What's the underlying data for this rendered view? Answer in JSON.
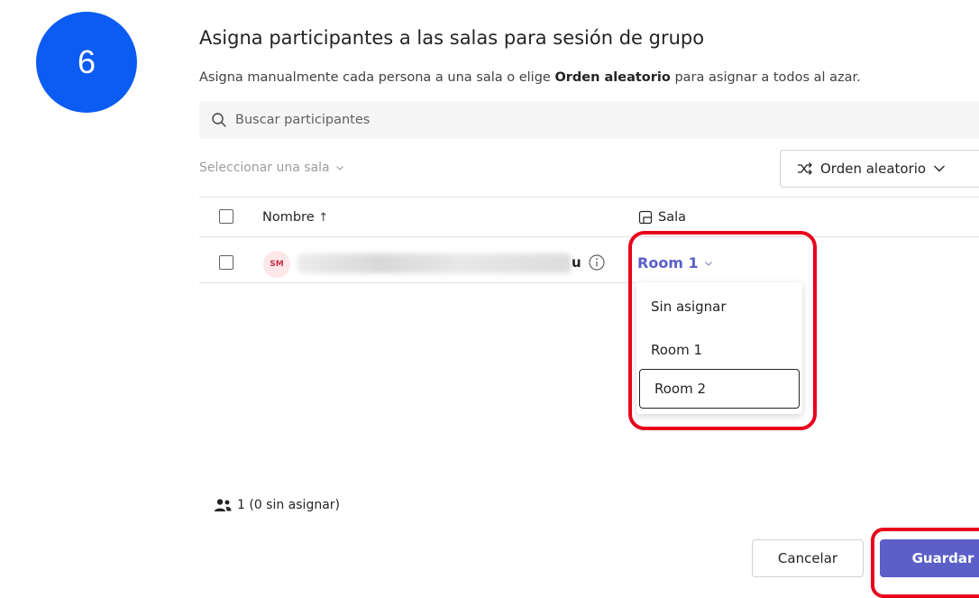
{
  "step_number": "6",
  "dialog": {
    "title": "Asigna participantes a las salas para sesión de grupo",
    "subtitle_prefix": "Asigna manualmente cada persona a una sala o elige ",
    "subtitle_bold": "Orden aleatorio",
    "subtitle_suffix": " para asignar a todos al azar."
  },
  "search": {
    "placeholder": "Buscar participantes",
    "icon": "search-icon"
  },
  "room_filter": {
    "label": "Seleccionar una sala",
    "icon": "chevron-down-icon"
  },
  "shuffle_button": {
    "label": "Orden aleatorio",
    "icon": "shuffle-icon"
  },
  "table": {
    "columns": [
      {
        "label": "Nombre",
        "sort": "ascending"
      },
      {
        "label": "Sala",
        "icon": "room-icon"
      }
    ],
    "rows": [
      {
        "initials": "SM",
        "name_visible_tail": "u",
        "room": "Room 1"
      }
    ]
  },
  "room_menu": {
    "options": [
      "Sin asignar",
      "Room 1",
      "Room 2"
    ],
    "focused": "Room 2"
  },
  "participant_count": "1 (0 sin asignar)",
  "footer": {
    "cancel_label": "Cancelar",
    "save_label": "Guardar"
  },
  "colors": {
    "accent": "#5b5fc7",
    "badge": "#0b5cf2",
    "highlight": "#e8001c"
  }
}
